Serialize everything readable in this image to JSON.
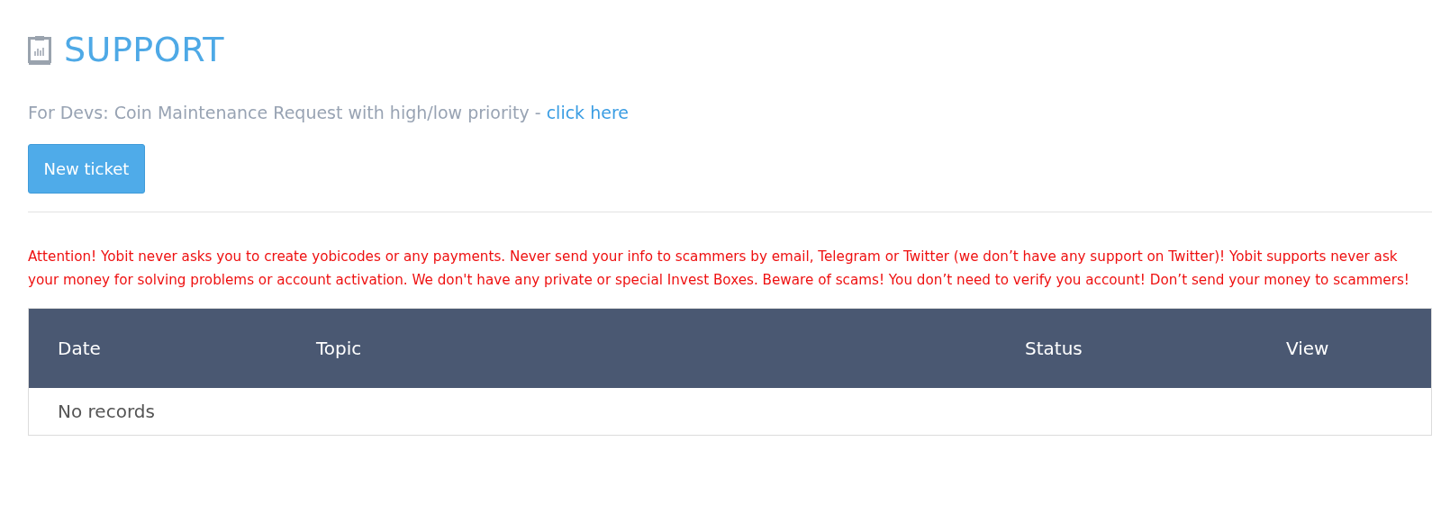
{
  "title": "SUPPORT",
  "dev_note": {
    "text": "For Devs: Coin Maintenance Request with high/low priority -",
    "link": "click here"
  },
  "new_ticket_button": "New ticket",
  "warning": "Attention! Yobit never asks you to create yobicodes or any payments. Never send your info to scammers by email, Telegram or Twitter (we don’t have any support on Twitter)! Yobit supports never ask your money for solving problems or account activation. We don't have any private or special Invest Boxes. Beware of scams! You don’t need to verify you account! Don’t send your money to scammers!",
  "table": {
    "columns": [
      "Date",
      "Topic",
      "Status",
      "View"
    ],
    "empty_message": "No records"
  }
}
